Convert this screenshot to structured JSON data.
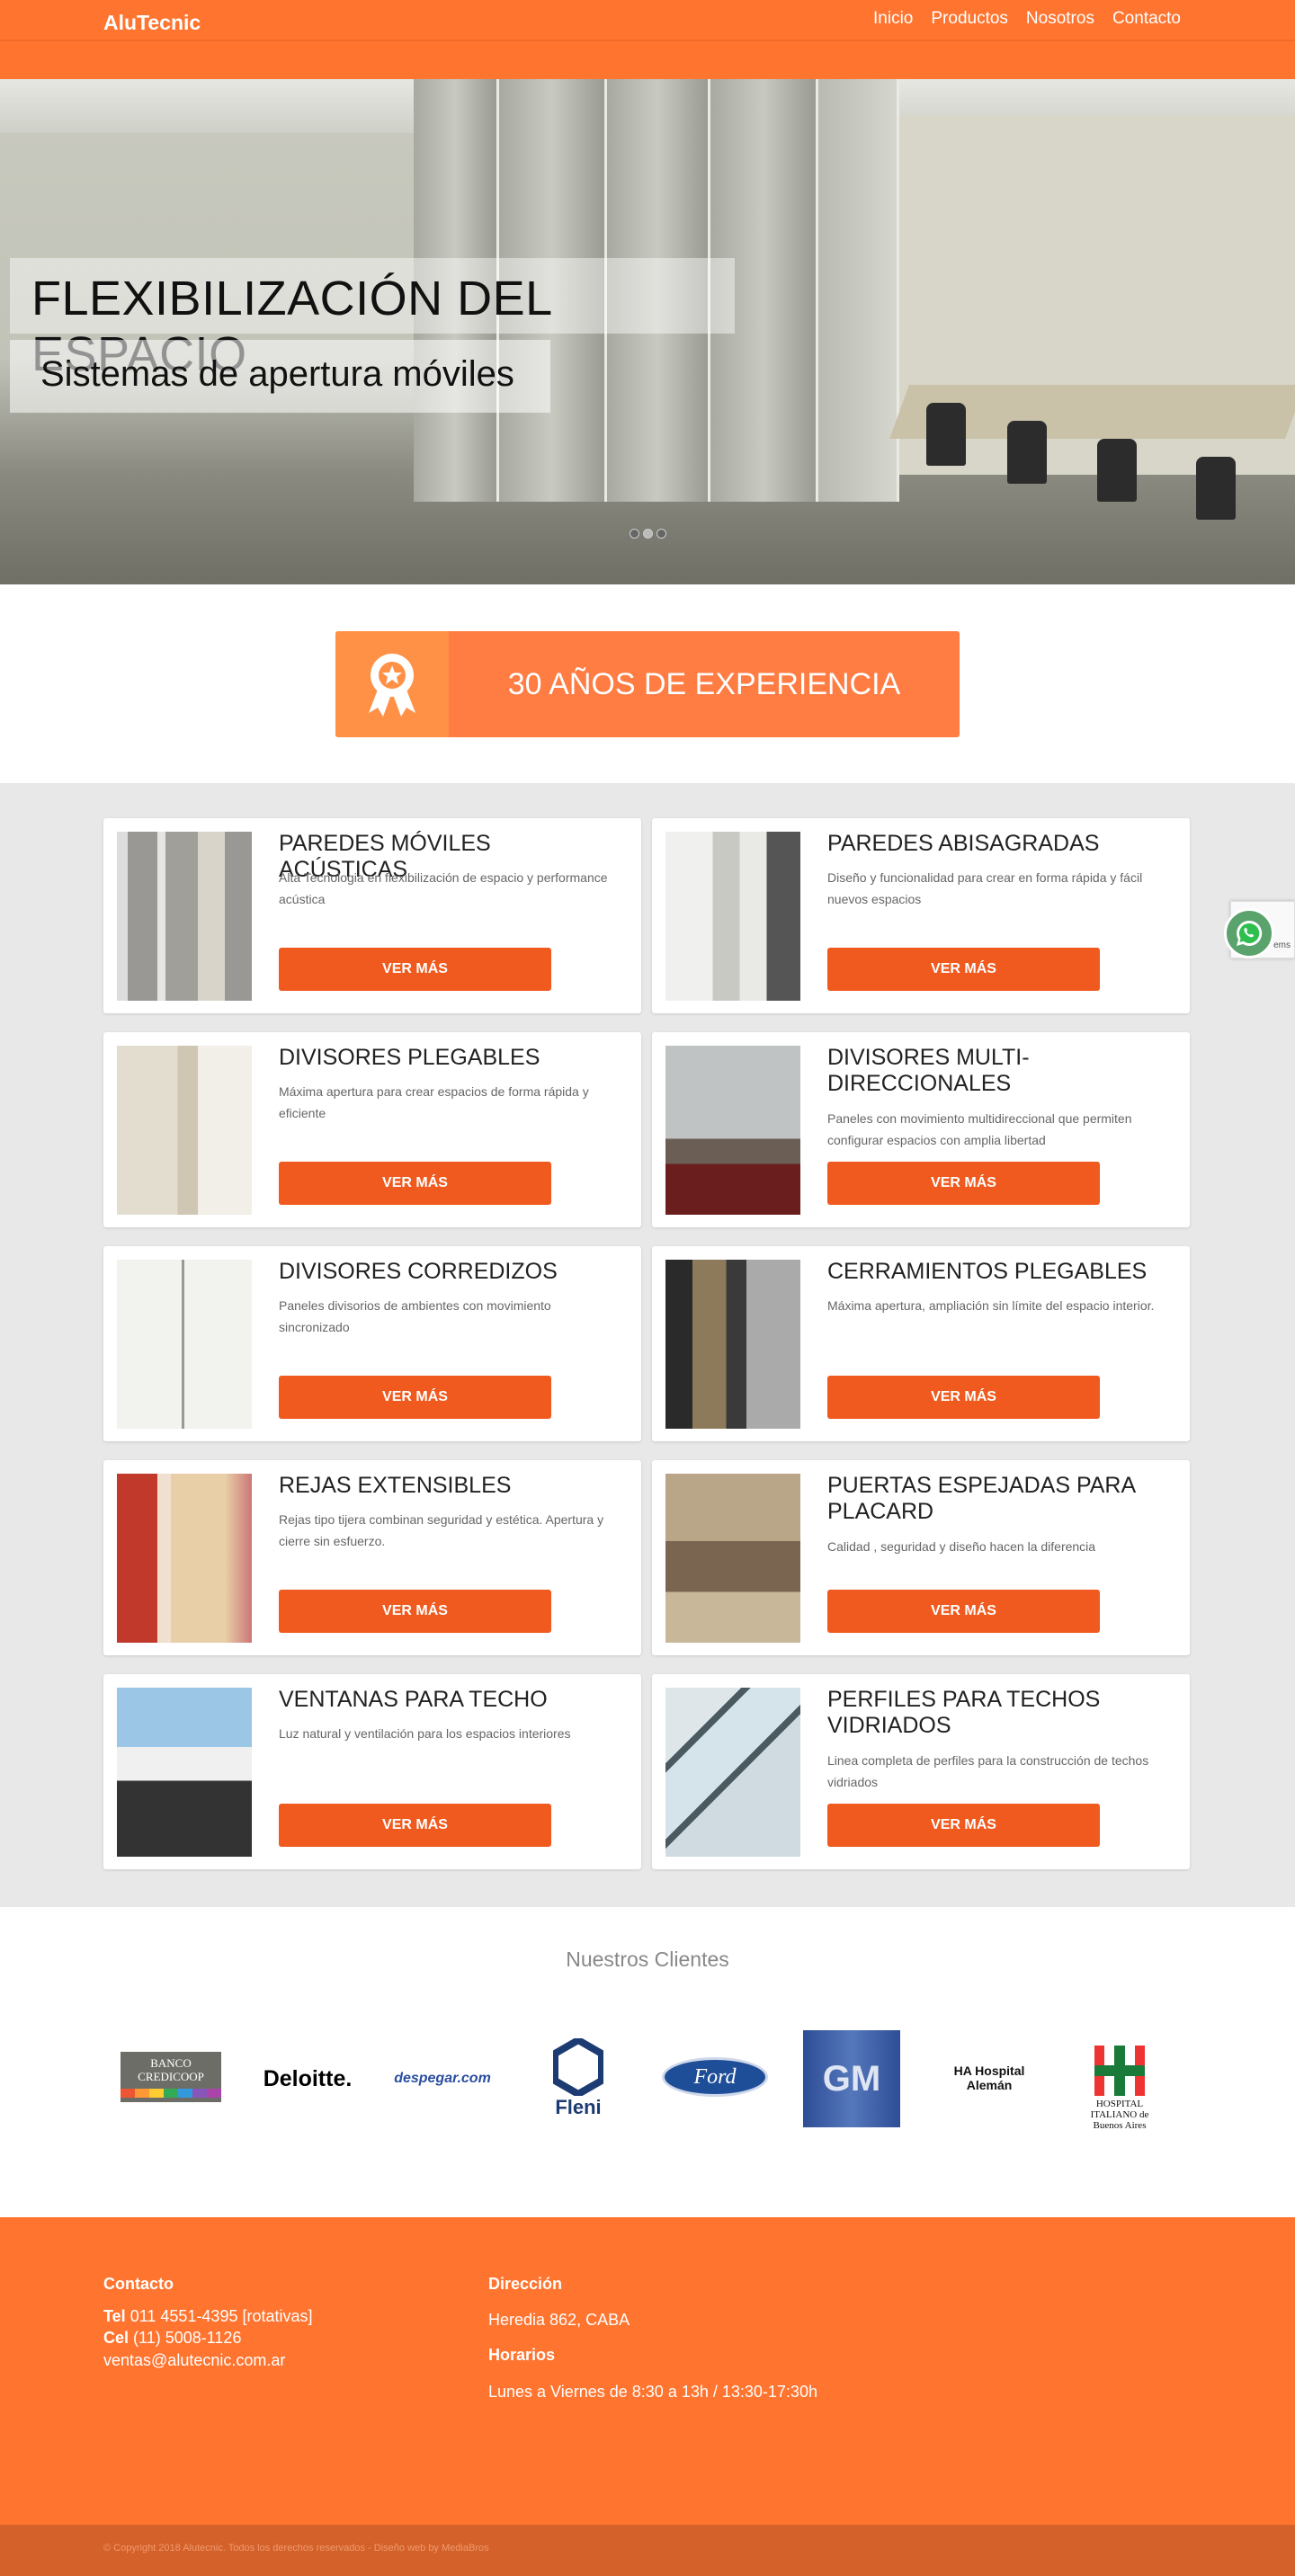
{
  "header": {
    "logo": "AluTecnic",
    "nav": [
      "Inicio",
      "Productos",
      "Nosotros",
      "Contacto"
    ]
  },
  "hero": {
    "title": "FLEXIBILIZACIÓN DEL ESPACIO",
    "subtitle": "Sistemas de apertura móviles",
    "slide_count": 3,
    "active_slide": 2
  },
  "experience": {
    "icon": "award-ribbon-icon",
    "label": "30 AÑOS DE EXPERIENCIA"
  },
  "products": [
    {
      "title": "PAREDES MÓVILES ACÚSTICAS",
      "desc": "Alta Tecnologia en flexibilización de espacio y performance acústica",
      "button": "VER MÁS"
    },
    {
      "title": "PAREDES ABISAGRADAS",
      "desc": "Diseño y funcionalidad para crear en forma rápida y fácil nuevos espacios",
      "button": "VER MÁS"
    },
    {
      "title": "DIVISORES PLEGABLES",
      "desc": "Máxima apertura para crear espacios de forma rápida y eficiente",
      "button": "VER MÁS"
    },
    {
      "title": "DIVISORES MULTI- DIRECCIONALES",
      "desc": "Paneles con movimiento multidireccional que permiten configurar espacios con amplia libertad",
      "button": "VER MÁS"
    },
    {
      "title": "DIVISORES CORREDIZOS",
      "desc": "Paneles divisorios de ambientes con movimiento sincronizado",
      "button": "VER MÁS"
    },
    {
      "title": "CERRAMIENTOS PLEGABLES",
      "desc": "Máxima apertura, ampliación sin límite del espacio interior.",
      "button": "VER MÁS"
    },
    {
      "title": "REJAS EXTENSIBLES",
      "desc": "Rejas tipo tijera combinan seguridad y estética. Apertura y cierre sin esfuerzo.",
      "button": "VER MÁS"
    },
    {
      "title": "PUERTAS ESPEJADAS PARA PLACARD",
      "desc": "Calidad , seguridad y diseño hacen la diferencia",
      "button": "VER MÁS"
    },
    {
      "title": "VENTANAS PARA TECHO",
      "desc": "Luz natural y ventilación para los espacios interiores",
      "button": "VER MÁS"
    },
    {
      "title": "PERFILES PARA TECHOS VIDRIADOS",
      "desc": "Linea completa de perfiles para la construcción de techos vidriados",
      "button": "VER MÁS"
    }
  ],
  "clients": {
    "title": "Nuestros Clientes",
    "logos": [
      "BANCO CREDICOOP",
      "Deloitte.",
      "despegar.com",
      "Fleni",
      "Ford",
      "GM",
      "HA Hospital Alemán",
      "HOSPITAL ITALIANO de Buenos Aires"
    ]
  },
  "footer": {
    "contact_title": "Contacto",
    "tel_label": "Tel",
    "tel": "011 4551-4395 [rotativas]",
    "cel_label": "Cel",
    "cel": "(11) 5008-1126",
    "email": "ventas@alutecnic.com.ar",
    "address_title": "Dirección",
    "address": "Heredia 862, CABA",
    "hours_title": "Horarios",
    "hours": "Lunes a Viernes de 8:30 a 13h / 13:30-17:30h",
    "copyright": "© Copyright 2018 Alutecnic. Todos los derechos reservados - Diseño web by MediaBros"
  },
  "widgets": {
    "recaptcha_text": "ems",
    "whatsapp": "whatsapp-icon"
  },
  "colors": {
    "brand": "#ff742f",
    "button": "#f05a1e",
    "footer_bottom": "#d4612a"
  }
}
